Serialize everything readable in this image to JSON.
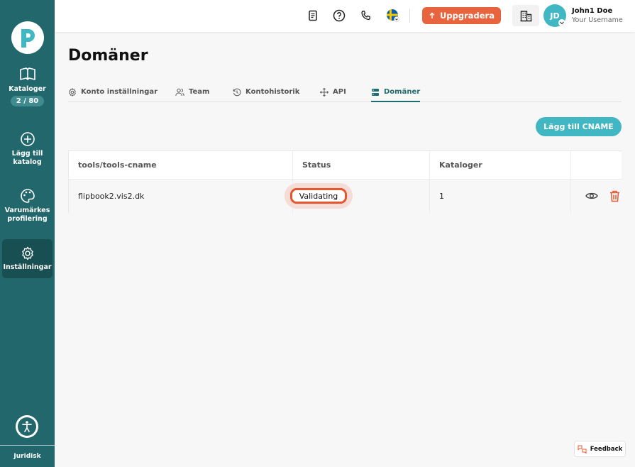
{
  "sidebar": {
    "logo_letter": "P",
    "catalogs": {
      "label": "Kataloger",
      "count": "2 / 80"
    },
    "add_catalog": {
      "label_line1": "Lägg till",
      "label_line2": "katalog"
    },
    "branding": {
      "label_line1": "Varumärkes",
      "label_line2": "profilering"
    },
    "settings": {
      "label": "Inställningar"
    },
    "legal": "Juridisk"
  },
  "topbar": {
    "upgrade_label": "Uppgradera",
    "avatar_initials": "JD",
    "user_name": "John1 Doe",
    "user_sub": "Your Username"
  },
  "page": {
    "title": "Domäner",
    "tabs": [
      {
        "label": "Konto inställningar"
      },
      {
        "label": "Team"
      },
      {
        "label": "Kontohistorik"
      },
      {
        "label": "API"
      },
      {
        "label": "Domäner"
      }
    ],
    "add_cname_label": "Lägg till CNAME"
  },
  "table": {
    "headers": [
      "tools/tools-cname",
      "Status",
      "Kataloger"
    ],
    "rows": [
      {
        "domain": "flipbook2.vis2.dk",
        "status": "Validating",
        "catalogs": "1"
      }
    ]
  },
  "feedback_label": "Feedback",
  "colors": {
    "sidebar": "#21676b",
    "accent": "#41b7c4",
    "upgrade": "#e8643e",
    "status_border": "#e4572e"
  }
}
